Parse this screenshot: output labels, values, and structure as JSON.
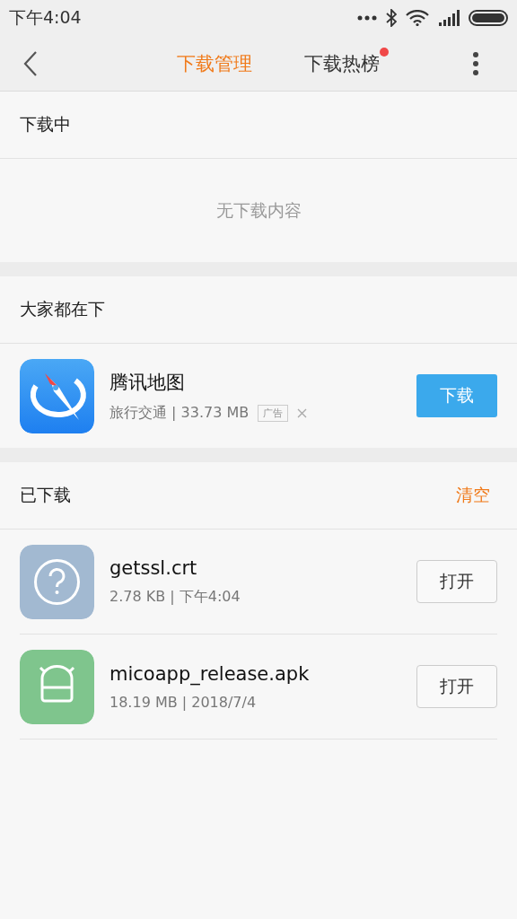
{
  "status_bar": {
    "time": "下午4:04"
  },
  "tabs": [
    {
      "label": "下载管理",
      "selected": true,
      "badge": false
    },
    {
      "label": "下载热榜",
      "selected": false,
      "badge": true
    }
  ],
  "downloading": {
    "title": "下载中",
    "empty_text": "无下载内容"
  },
  "popular": {
    "title": "大家都在下",
    "apps": [
      {
        "name": "腾讯地图",
        "category": "旅行交通 | 33.73 MB",
        "ad_label": "广告",
        "button": "下载"
      }
    ]
  },
  "downloaded": {
    "title": "已下载",
    "clear": "清空",
    "items": [
      {
        "kind": "unknown",
        "name": "getssl.crt",
        "meta": "2.78 KB | 下午4:04",
        "button": "打开"
      },
      {
        "kind": "apk",
        "name": "micoapp_release.apk",
        "meta": "18.19 MB | 2018/7/4",
        "button": "打开"
      }
    ]
  }
}
